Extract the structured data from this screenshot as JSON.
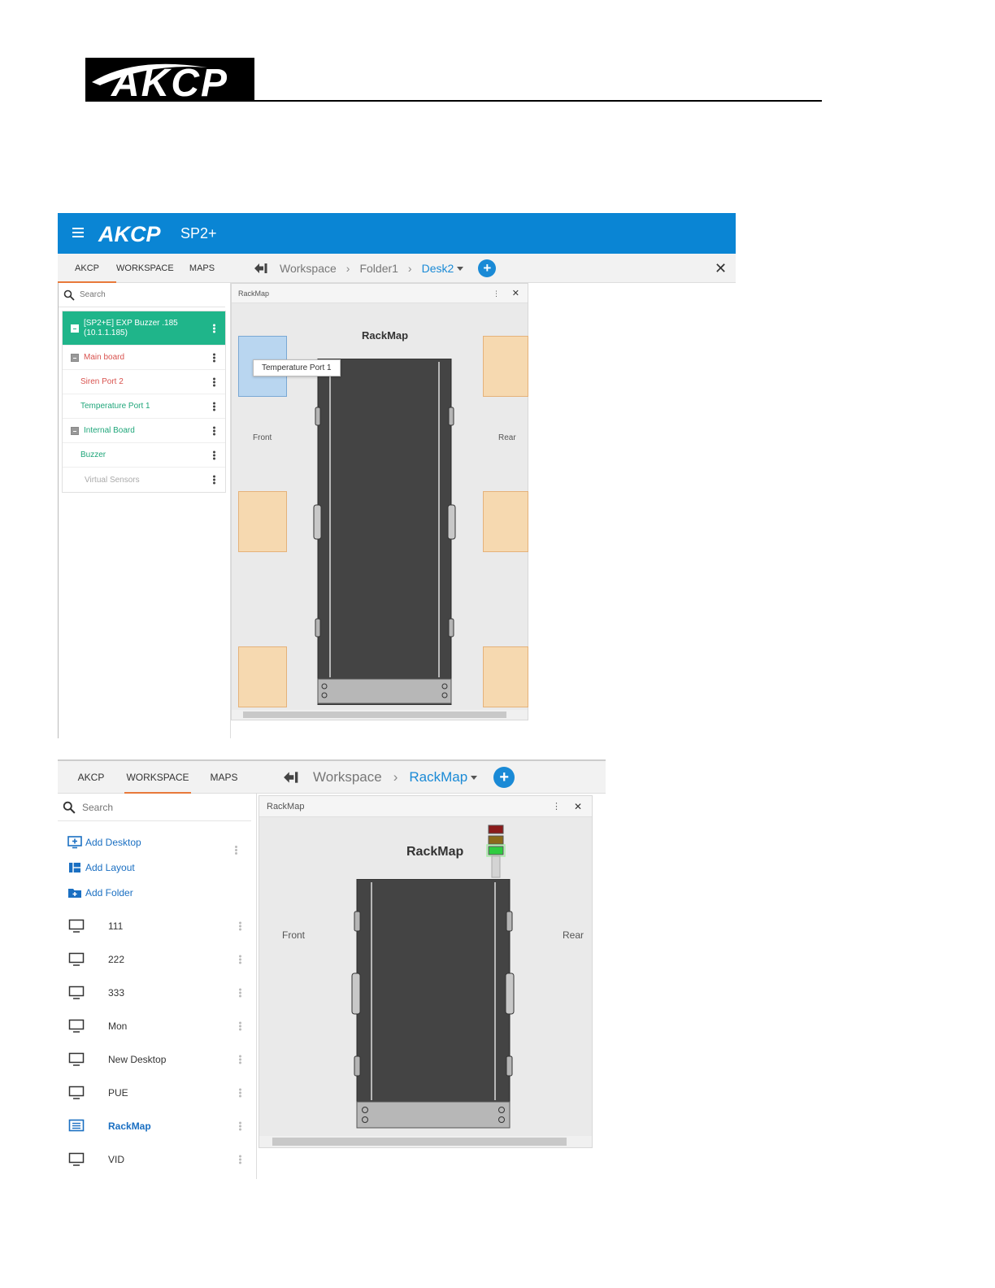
{
  "document": {
    "logo_text": "AKCP"
  },
  "shot1": {
    "brand": {
      "logo": "AKCP",
      "product": "SP2+"
    },
    "tabs": [
      {
        "label": "AKCP",
        "active": true
      },
      {
        "label": "WORKSPACE",
        "active": false
      },
      {
        "label": "MAPS",
        "active": false
      }
    ],
    "breadcrumb": [
      "Workspace",
      "Folder1",
      "Desk2"
    ],
    "search_placeholder": "Search",
    "tree": [
      {
        "label": "[SP2+E] EXP Buzzer .185",
        "label2": "(10.1.1.185)",
        "color": "#ffffff",
        "level": "root"
      },
      {
        "label": "Main board",
        "color": "#d9534f",
        "level": "group"
      },
      {
        "label": "Siren Port 2",
        "color": "#d9534f",
        "level": "child"
      },
      {
        "label": "Temperature Port 1",
        "color": "#1fa67a",
        "level": "child"
      },
      {
        "label": "Internal Board",
        "color": "#1fa67a",
        "level": "group"
      },
      {
        "label": "Buzzer",
        "color": "#1fa67a",
        "level": "child"
      },
      {
        "label": "Virtual Sensors",
        "color": "#aaaaaa",
        "level": "child"
      }
    ],
    "panel": {
      "header": "RackMap",
      "title": "RackMap",
      "front": "Front",
      "rear": "Rear",
      "tooltip": "Temperature Port 1"
    }
  },
  "shot2": {
    "tabs": [
      {
        "label": "AKCP",
        "active": false
      },
      {
        "label": "WORKSPACE",
        "active": true
      },
      {
        "label": "MAPS",
        "active": false
      }
    ],
    "breadcrumb": [
      "Workspace",
      "RackMap"
    ],
    "search_placeholder": "Search",
    "actions": [
      "Add Desktop",
      "Add Layout",
      "Add Folder"
    ],
    "items": [
      "111",
      "222",
      "333",
      "Mon",
      "New Desktop",
      "PUE",
      "RackMap",
      "VID"
    ],
    "active_item": "RackMap",
    "panel": {
      "header": "RackMap",
      "title": "RackMap",
      "front": "Front",
      "rear": "Rear"
    },
    "light_tower": [
      "#8b1a1a",
      "#8a6a1a",
      "#2ecc40"
    ]
  },
  "colors": {
    "topbar": "#0a85d4",
    "accent_blue": "#1a8ad6",
    "tab_underline": "#e8793a",
    "tree_root": "#1fb58a",
    "slot_orange": "#f6d9b0",
    "slot_selected": "#b9d6f0",
    "rack_body": "#444444"
  }
}
